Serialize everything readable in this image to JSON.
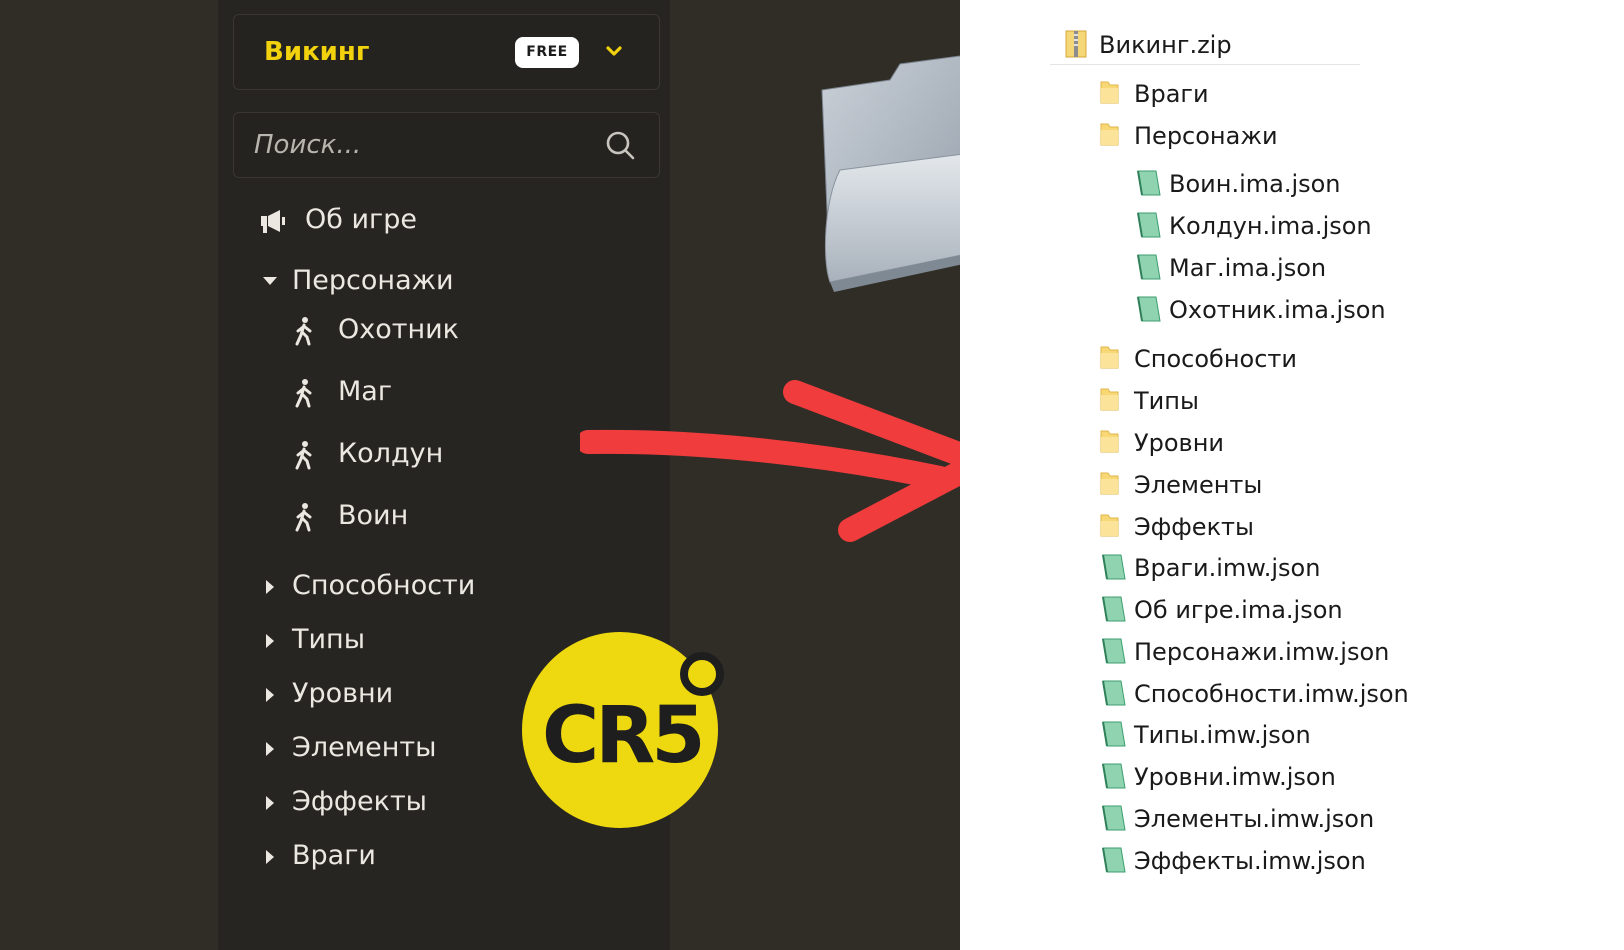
{
  "sidebar": {
    "project_name": "Викинг",
    "plan_badge": "FREE",
    "search_placeholder": "Поиск...",
    "about": "Об игре",
    "characters_group": "Персонажи",
    "characters": [
      "Охотник",
      "Маг",
      "Колдун",
      "Воин"
    ],
    "groups": [
      "Способности",
      "Типы",
      "Уровни",
      "Элементы",
      "Эффекты",
      "Враги"
    ]
  },
  "logo": {
    "text": "CR5"
  },
  "explorer": {
    "archive": "Викинг.zip",
    "folders_top": [
      "Враги",
      "Персонажи"
    ],
    "character_files": [
      "Воин.ima.json",
      "Колдун.ima.json",
      "Маг.ima.json",
      "Охотник.ima.json"
    ],
    "folders_bottom": [
      "Способности",
      "Типы",
      "Уровни",
      "Элементы",
      "Эффекты"
    ],
    "files": [
      "Враги.imw.json",
      "Об игре.ima.json",
      "Персонажи.imw.json",
      "Способности.imw.json",
      "Типы.imw.json",
      "Уровни.imw.json",
      "Элементы.imw.json",
      "Эффекты.imw.json"
    ]
  },
  "colors": {
    "accent": "#f2d10d",
    "sidebar_bg": "#272521",
    "arrow": "#f03c3c"
  }
}
